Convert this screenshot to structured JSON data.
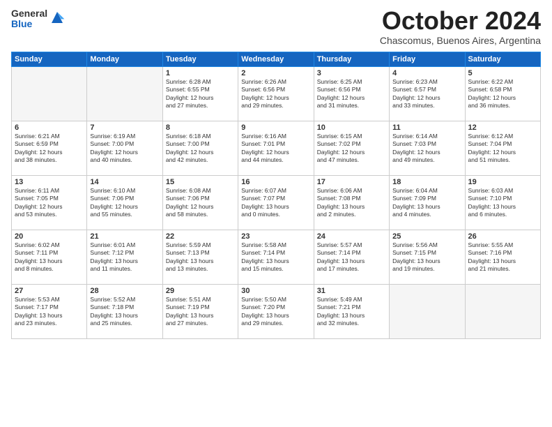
{
  "logo": {
    "line1": "General",
    "line2": "Blue"
  },
  "header": {
    "month": "October 2024",
    "location": "Chascomus, Buenos Aires, Argentina"
  },
  "weekdays": [
    "Sunday",
    "Monday",
    "Tuesday",
    "Wednesday",
    "Thursday",
    "Friday",
    "Saturday"
  ],
  "weeks": [
    [
      {
        "day": "",
        "info": ""
      },
      {
        "day": "",
        "info": ""
      },
      {
        "day": "1",
        "info": "Sunrise: 6:28 AM\nSunset: 6:55 PM\nDaylight: 12 hours\nand 27 minutes."
      },
      {
        "day": "2",
        "info": "Sunrise: 6:26 AM\nSunset: 6:56 PM\nDaylight: 12 hours\nand 29 minutes."
      },
      {
        "day": "3",
        "info": "Sunrise: 6:25 AM\nSunset: 6:56 PM\nDaylight: 12 hours\nand 31 minutes."
      },
      {
        "day": "4",
        "info": "Sunrise: 6:23 AM\nSunset: 6:57 PM\nDaylight: 12 hours\nand 33 minutes."
      },
      {
        "day": "5",
        "info": "Sunrise: 6:22 AM\nSunset: 6:58 PM\nDaylight: 12 hours\nand 36 minutes."
      }
    ],
    [
      {
        "day": "6",
        "info": "Sunrise: 6:21 AM\nSunset: 6:59 PM\nDaylight: 12 hours\nand 38 minutes."
      },
      {
        "day": "7",
        "info": "Sunrise: 6:19 AM\nSunset: 7:00 PM\nDaylight: 12 hours\nand 40 minutes."
      },
      {
        "day": "8",
        "info": "Sunrise: 6:18 AM\nSunset: 7:00 PM\nDaylight: 12 hours\nand 42 minutes."
      },
      {
        "day": "9",
        "info": "Sunrise: 6:16 AM\nSunset: 7:01 PM\nDaylight: 12 hours\nand 44 minutes."
      },
      {
        "day": "10",
        "info": "Sunrise: 6:15 AM\nSunset: 7:02 PM\nDaylight: 12 hours\nand 47 minutes."
      },
      {
        "day": "11",
        "info": "Sunrise: 6:14 AM\nSunset: 7:03 PM\nDaylight: 12 hours\nand 49 minutes."
      },
      {
        "day": "12",
        "info": "Sunrise: 6:12 AM\nSunset: 7:04 PM\nDaylight: 12 hours\nand 51 minutes."
      }
    ],
    [
      {
        "day": "13",
        "info": "Sunrise: 6:11 AM\nSunset: 7:05 PM\nDaylight: 12 hours\nand 53 minutes."
      },
      {
        "day": "14",
        "info": "Sunrise: 6:10 AM\nSunset: 7:06 PM\nDaylight: 12 hours\nand 55 minutes."
      },
      {
        "day": "15",
        "info": "Sunrise: 6:08 AM\nSunset: 7:06 PM\nDaylight: 12 hours\nand 58 minutes."
      },
      {
        "day": "16",
        "info": "Sunrise: 6:07 AM\nSunset: 7:07 PM\nDaylight: 13 hours\nand 0 minutes."
      },
      {
        "day": "17",
        "info": "Sunrise: 6:06 AM\nSunset: 7:08 PM\nDaylight: 13 hours\nand 2 minutes."
      },
      {
        "day": "18",
        "info": "Sunrise: 6:04 AM\nSunset: 7:09 PM\nDaylight: 13 hours\nand 4 minutes."
      },
      {
        "day": "19",
        "info": "Sunrise: 6:03 AM\nSunset: 7:10 PM\nDaylight: 13 hours\nand 6 minutes."
      }
    ],
    [
      {
        "day": "20",
        "info": "Sunrise: 6:02 AM\nSunset: 7:11 PM\nDaylight: 13 hours\nand 8 minutes."
      },
      {
        "day": "21",
        "info": "Sunrise: 6:01 AM\nSunset: 7:12 PM\nDaylight: 13 hours\nand 11 minutes."
      },
      {
        "day": "22",
        "info": "Sunrise: 5:59 AM\nSunset: 7:13 PM\nDaylight: 13 hours\nand 13 minutes."
      },
      {
        "day": "23",
        "info": "Sunrise: 5:58 AM\nSunset: 7:14 PM\nDaylight: 13 hours\nand 15 minutes."
      },
      {
        "day": "24",
        "info": "Sunrise: 5:57 AM\nSunset: 7:14 PM\nDaylight: 13 hours\nand 17 minutes."
      },
      {
        "day": "25",
        "info": "Sunrise: 5:56 AM\nSunset: 7:15 PM\nDaylight: 13 hours\nand 19 minutes."
      },
      {
        "day": "26",
        "info": "Sunrise: 5:55 AM\nSunset: 7:16 PM\nDaylight: 13 hours\nand 21 minutes."
      }
    ],
    [
      {
        "day": "27",
        "info": "Sunrise: 5:53 AM\nSunset: 7:17 PM\nDaylight: 13 hours\nand 23 minutes."
      },
      {
        "day": "28",
        "info": "Sunrise: 5:52 AM\nSunset: 7:18 PM\nDaylight: 13 hours\nand 25 minutes."
      },
      {
        "day": "29",
        "info": "Sunrise: 5:51 AM\nSunset: 7:19 PM\nDaylight: 13 hours\nand 27 minutes."
      },
      {
        "day": "30",
        "info": "Sunrise: 5:50 AM\nSunset: 7:20 PM\nDaylight: 13 hours\nand 29 minutes."
      },
      {
        "day": "31",
        "info": "Sunrise: 5:49 AM\nSunset: 7:21 PM\nDaylight: 13 hours\nand 32 minutes."
      },
      {
        "day": "",
        "info": ""
      },
      {
        "day": "",
        "info": ""
      }
    ]
  ]
}
